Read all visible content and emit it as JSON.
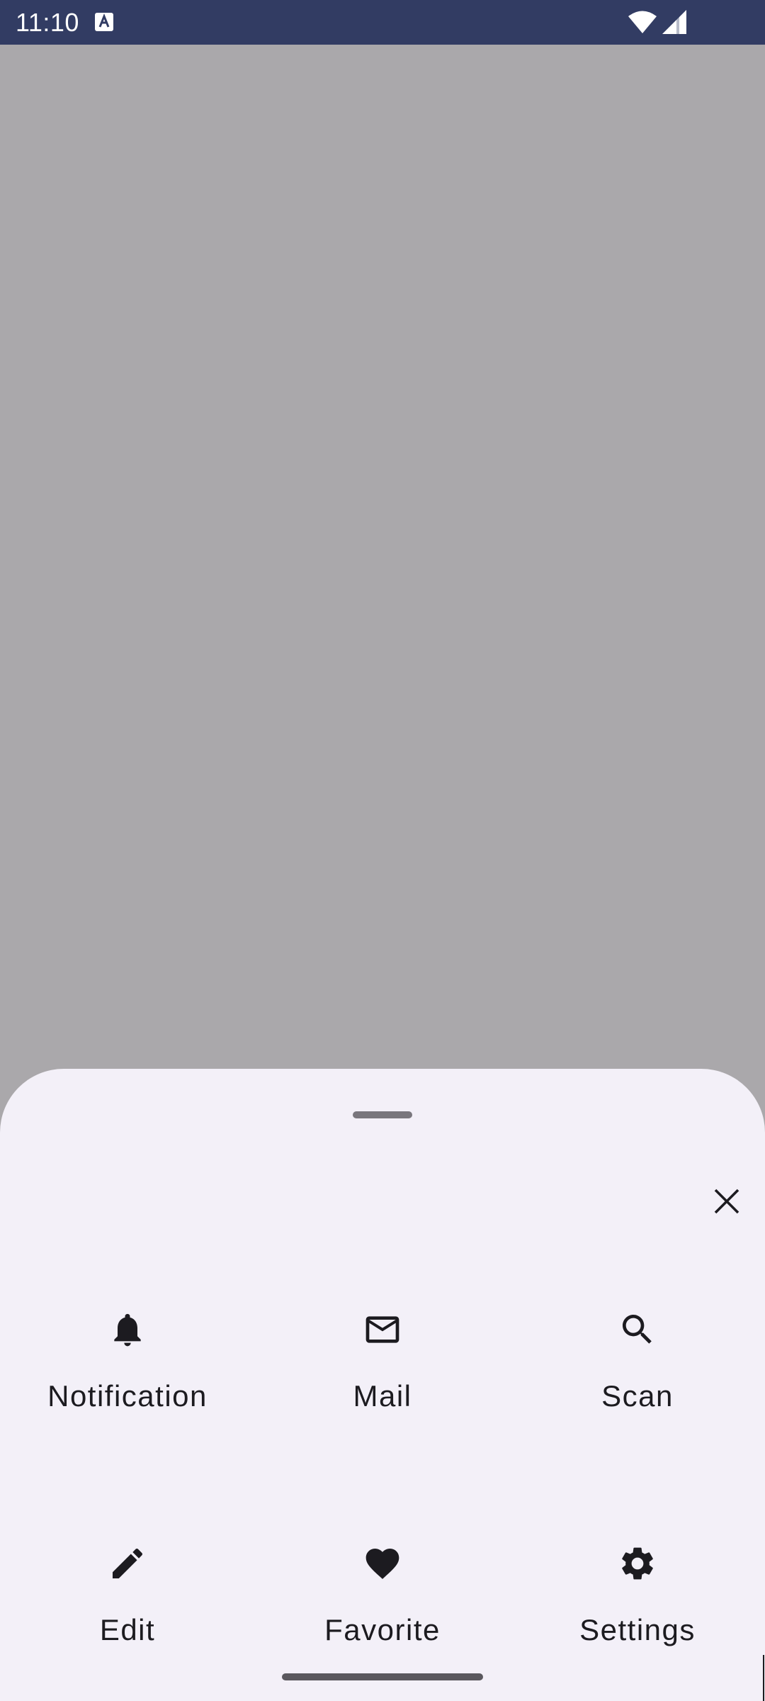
{
  "status_bar": {
    "time": "11:10",
    "icons": [
      "text-a-icon",
      "wifi-icon",
      "signal-icon"
    ]
  },
  "bottom_sheet": {
    "close_icon": "close-icon",
    "actions": [
      {
        "label": "Notification",
        "icon": "bell-icon"
      },
      {
        "label": "Mail",
        "icon": "mail-icon"
      },
      {
        "label": "Scan",
        "icon": "search-icon"
      },
      {
        "label": "Edit",
        "icon": "pencil-icon"
      },
      {
        "label": "Favorite",
        "icon": "heart-icon"
      },
      {
        "label": "Settings",
        "icon": "gear-icon"
      }
    ]
  },
  "colors": {
    "status_bar": "#323c63",
    "scrim": "#aaa8ab",
    "sheet_background": "#f3f0f8",
    "text": "#1c1b20"
  }
}
